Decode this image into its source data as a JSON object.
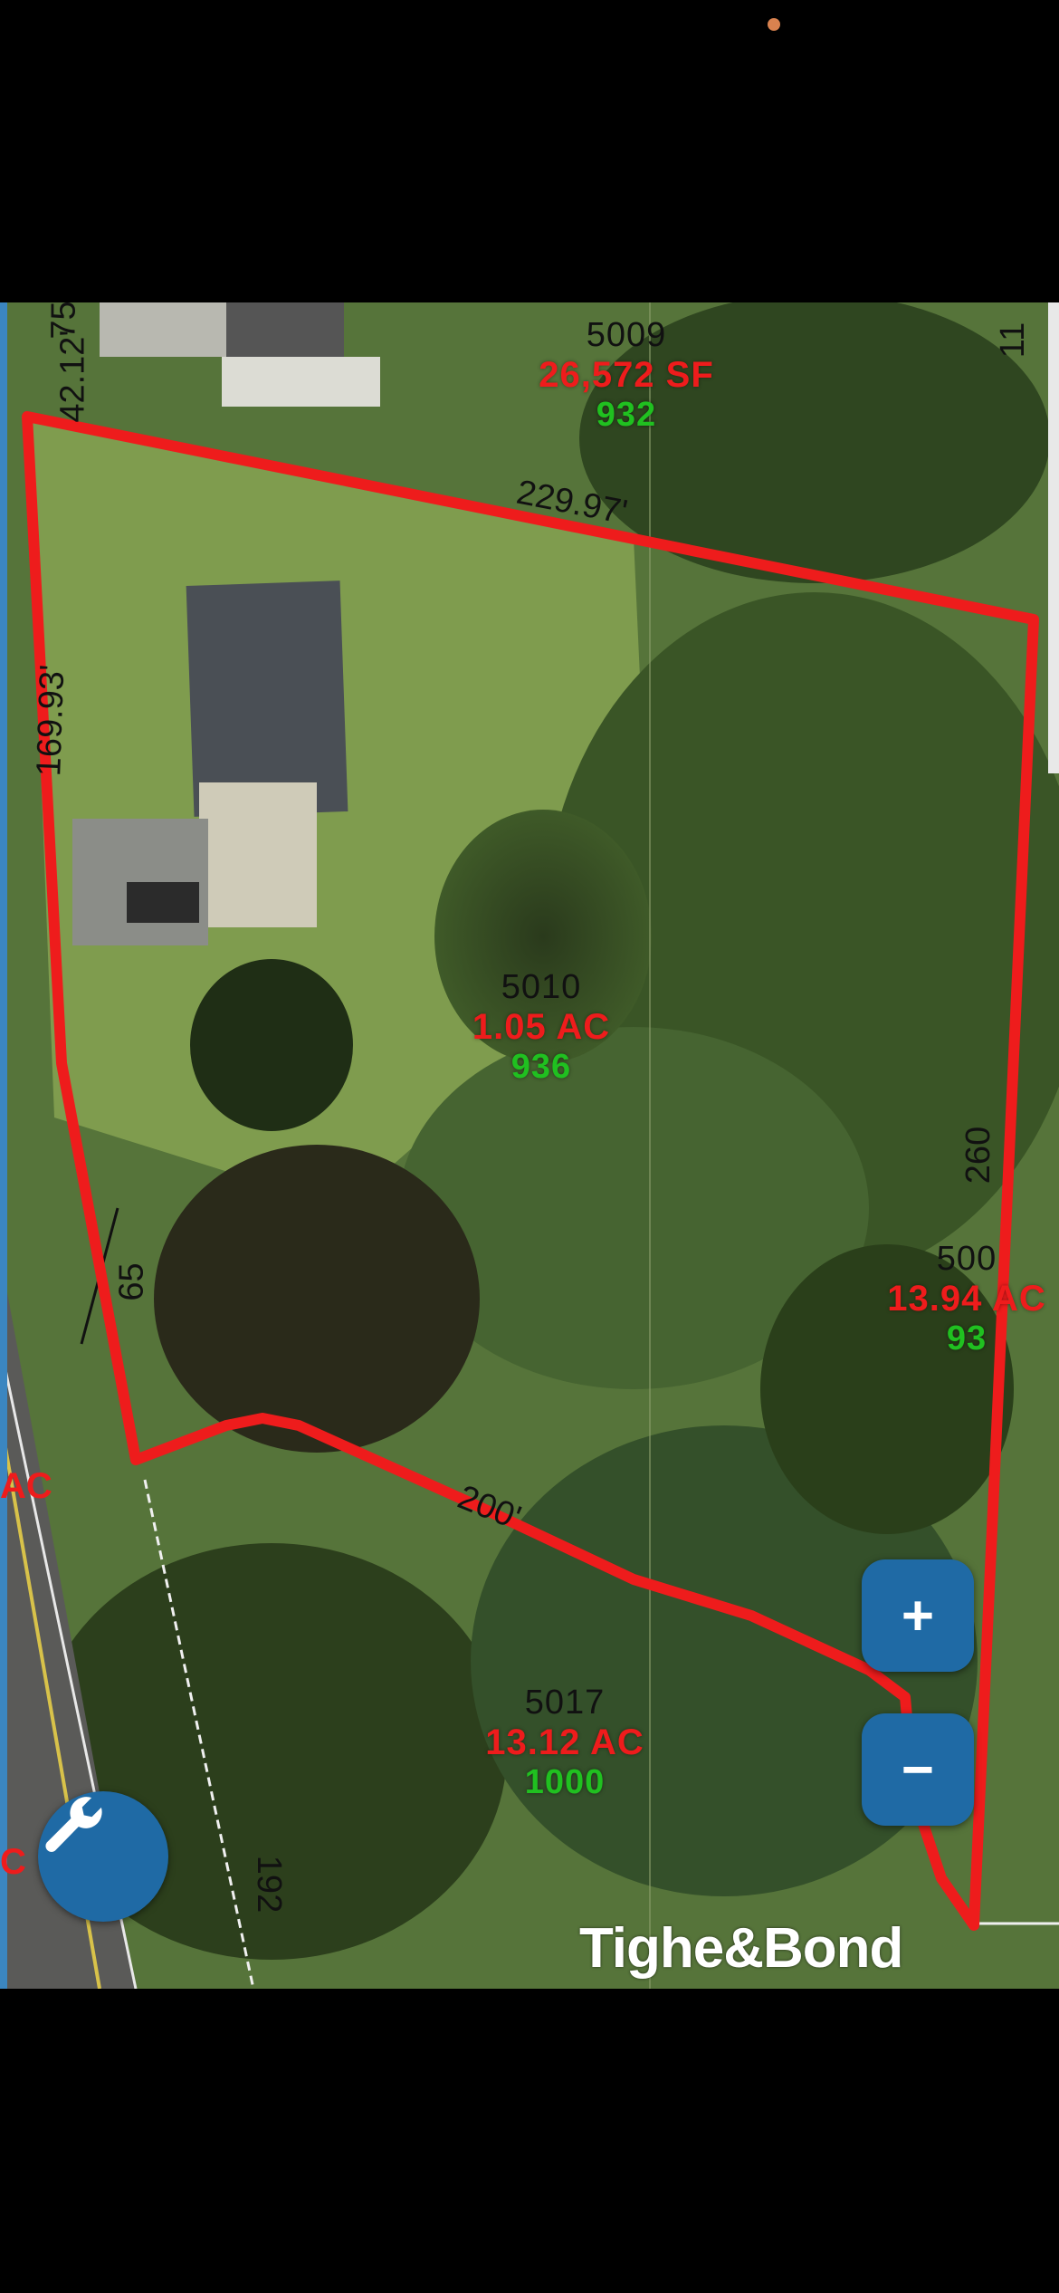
{
  "map": {
    "parcels": [
      {
        "id": "5009",
        "area": "26,572 SF",
        "code": "932"
      },
      {
        "id": "5010",
        "area": "1.05 AC",
        "code": "936"
      },
      {
        "id": "500",
        "area": "13.94 AC",
        "code": "93"
      },
      {
        "id": "5017",
        "area": "13.12 AC",
        "code": "1000"
      }
    ],
    "dimensions": [
      "229.97'",
      "169.93'",
      "260",
      "200'",
      "65",
      "42.12'",
      "75",
      "11",
      "192"
    ],
    "edge_fragments": [
      "AC",
      "C"
    ],
    "controls": {
      "zoom_in": "+",
      "zoom_out": "−"
    },
    "logo": "Tighe&Bond",
    "colors": {
      "boundary": "#ee1c1c",
      "area_text": "#ee1c1c",
      "elevation_text": "#20c020",
      "buttons": "#1f6aa5"
    },
    "icons": [
      "wrench-icon"
    ]
  }
}
